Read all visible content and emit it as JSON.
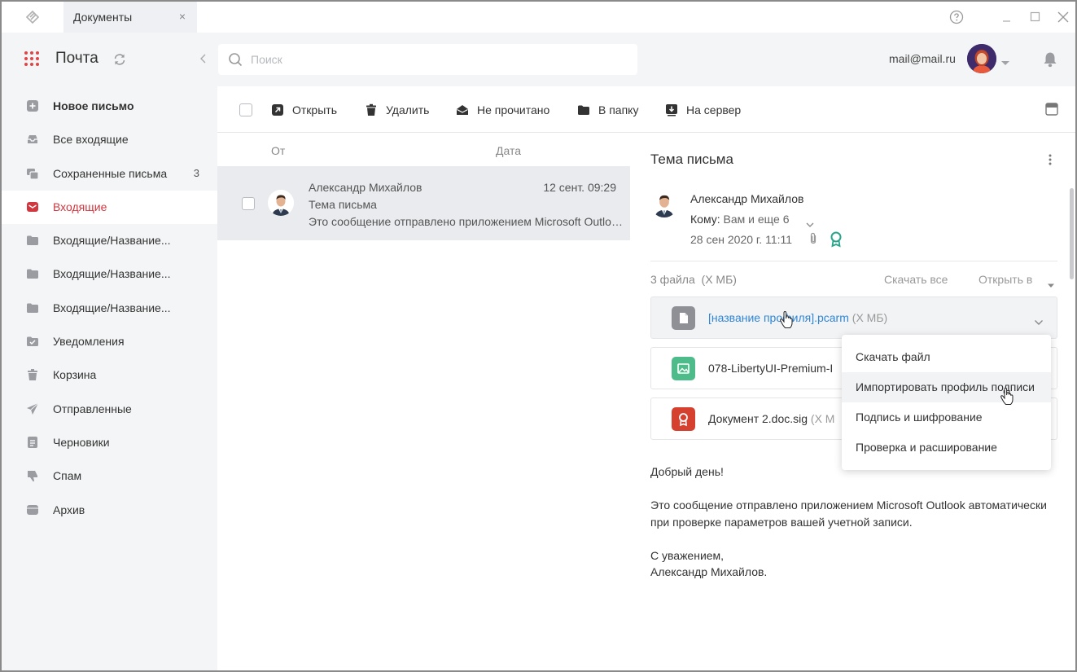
{
  "titlebar": {
    "tab_label": "Документы",
    "tab_close": "×"
  },
  "sidebar": {
    "title": "Почта",
    "items": [
      {
        "label": "Новое письмо",
        "icon": "plus-square-icon"
      },
      {
        "label": "Все входящие",
        "icon": "inbox-tray-icon"
      },
      {
        "label": "Сохраненные письма",
        "icon": "saved-mails-icon",
        "count": "3"
      },
      {
        "label": "Входящие",
        "icon": "mail-envelope-icon",
        "active": true
      },
      {
        "label": "Входящие/Название...",
        "icon": "folder-icon"
      },
      {
        "label": "Входящие/Название...",
        "icon": "folder-icon"
      },
      {
        "label": "Входящие/Название...",
        "icon": "folder-icon"
      },
      {
        "label": "Уведомления",
        "icon": "folder-check-icon"
      },
      {
        "label": "Корзина",
        "icon": "trash-icon"
      },
      {
        "label": "Отправленные",
        "icon": "paper-plane-icon"
      },
      {
        "label": "Черновики",
        "icon": "draft-doc-icon"
      },
      {
        "label": "Спам",
        "icon": "thumbs-down-icon"
      },
      {
        "label": "Архив",
        "icon": "archive-icon"
      }
    ]
  },
  "search": {
    "placeholder": "Поиск"
  },
  "account": {
    "email": "mail@mail.ru"
  },
  "toolbar": {
    "open_label": "Открыть",
    "delete_label": "Удалить",
    "unread_label": "Не прочитано",
    "folder_label": "В папку",
    "server_label": "На сервер"
  },
  "list": {
    "col_from": "От",
    "col_date": "Дата",
    "messages": [
      {
        "from": "Александр Михайлов",
        "date": "12 сент. 09:29",
        "subject": "Тема письма",
        "preview": "Это сообщение отправлено приложением Microsoft Outlook автоматически при проверке параметров вашей учетной записи."
      }
    ]
  },
  "reader": {
    "subject": "Тема письма",
    "from": "Александр Михайлов",
    "to_label": "Кому:",
    "to_value": "Вам и еще 6",
    "date": "28 сен 2020 г. 11:11",
    "files": {
      "count": "3 файла",
      "total_size": "(Х МБ)",
      "download_all": "Скачать все",
      "open_in": "Открыть в",
      "items": [
        {
          "name": "[название профиля].pcarm",
          "size": "(Х МБ)",
          "icon": "file-doc-icon",
          "color": "#8e9096"
        },
        {
          "name": "078-LibertyUI-Premium-I",
          "size": "",
          "icon": "image-file-icon",
          "color": "#4dbb8a"
        },
        {
          "name": "Документ 2.doc.sig",
          "size": "(Х М",
          "icon": "certificate-file-icon",
          "color": "#d6402f"
        }
      ]
    },
    "body": {
      "greeting": "Добрый день!",
      "paragraph": "Это сообщение отправлено приложением Microsoft Outlook автоматически при проверке параметров вашей учетной записи.",
      "regards": "С уважением,",
      "signature": "Александр Михайлов."
    }
  },
  "menu": {
    "items": [
      "Скачать файл",
      "Импортировать профиль подписи",
      "Подпись и шифрование",
      "Проверка и расширование"
    ]
  },
  "colors": {
    "accent_red": "#d0373f",
    "link_blue": "#2f86d6",
    "cert_green": "#27a58a"
  }
}
